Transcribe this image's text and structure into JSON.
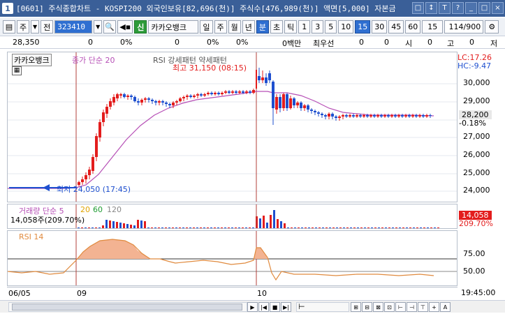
{
  "window": {
    "app_icon": "1",
    "title": "[0601] 주식종합차트 - KOSPI200 외국인보유[82,696(천)] 주식수[476,989(천)] 액면[5,000] 자본금",
    "buttons": [
      "□",
      "↕",
      "T",
      "?",
      "_",
      "□",
      "×"
    ]
  },
  "toolbar": {
    "market": "주",
    "code_prefix": "전",
    "code": "323410",
    "credit": "신",
    "stock_name": "카카오뱅크",
    "periods": [
      "일",
      "주",
      "월",
      "년",
      "분",
      "초",
      "틱"
    ],
    "period_selected": "분",
    "intervals": [
      "1",
      "3",
      "5",
      "10",
      "15",
      "30",
      "45",
      "60"
    ],
    "interval_selected": "15",
    "interval_value": "15",
    "count": "114/900"
  },
  "info_row": {
    "price": "28,350",
    "vals": [
      "0",
      "0%",
      "0",
      "0%",
      "0%"
    ],
    "col2": "0",
    "unit": "0백만",
    "best_bid": "최우선",
    "f1": "0",
    "f2": "0",
    "open_lbl": "시",
    "open": "0",
    "high_lbl": "고",
    "high": "0",
    "low_lbl": "저"
  },
  "price_panel": {
    "stock_label": "카카오뱅크",
    "ma_label": "종가 단순 20",
    "pattern_label": "RSI 강세패턴  약세패턴",
    "high_note": "최고 31,150 (08:15)",
    "low_note": "최저 24,050 (17:45)",
    "lc": "LC:17.26",
    "hc": "HC:-9.47",
    "y_ticks": [
      "30,000",
      "29,000",
      "28,000",
      "27,000",
      "26,000",
      "25,000",
      "24,000"
    ],
    "current_price": "28,200",
    "current_change": "-0.18%"
  },
  "volume_panel": {
    "label": "거래량 단순 5",
    "ma_20": "20",
    "ma_60": "60",
    "ma_120": "120",
    "value_note": "14,058주(209.70%)",
    "current_vol": "14,058",
    "current_pct": "209.70%"
  },
  "rsi_panel": {
    "label": "RSI 14",
    "y_ticks": [
      "75.00",
      "50.00"
    ]
  },
  "x_axis": {
    "labels": [
      "06/05",
      "09",
      "10"
    ],
    "time": "19:45:00"
  },
  "scroll": {
    "buttons": [
      "▶",
      "|◀",
      "■",
      "▶|"
    ],
    "zoom": "⊢",
    "tools": [
      "⊞",
      "⊟",
      "⊠",
      "⊡",
      "⊢",
      "⊣",
      "⊤",
      "+",
      "A"
    ]
  },
  "colors": {
    "bull": "#e31d1d",
    "bear": "#1e4fcf",
    "ma": "#b64fb6",
    "rsi_line": "#e08a3e",
    "rsi_fill": "#f3b392",
    "title_bar": "#3a5f98",
    "selected": "#2f6fd1"
  }
}
